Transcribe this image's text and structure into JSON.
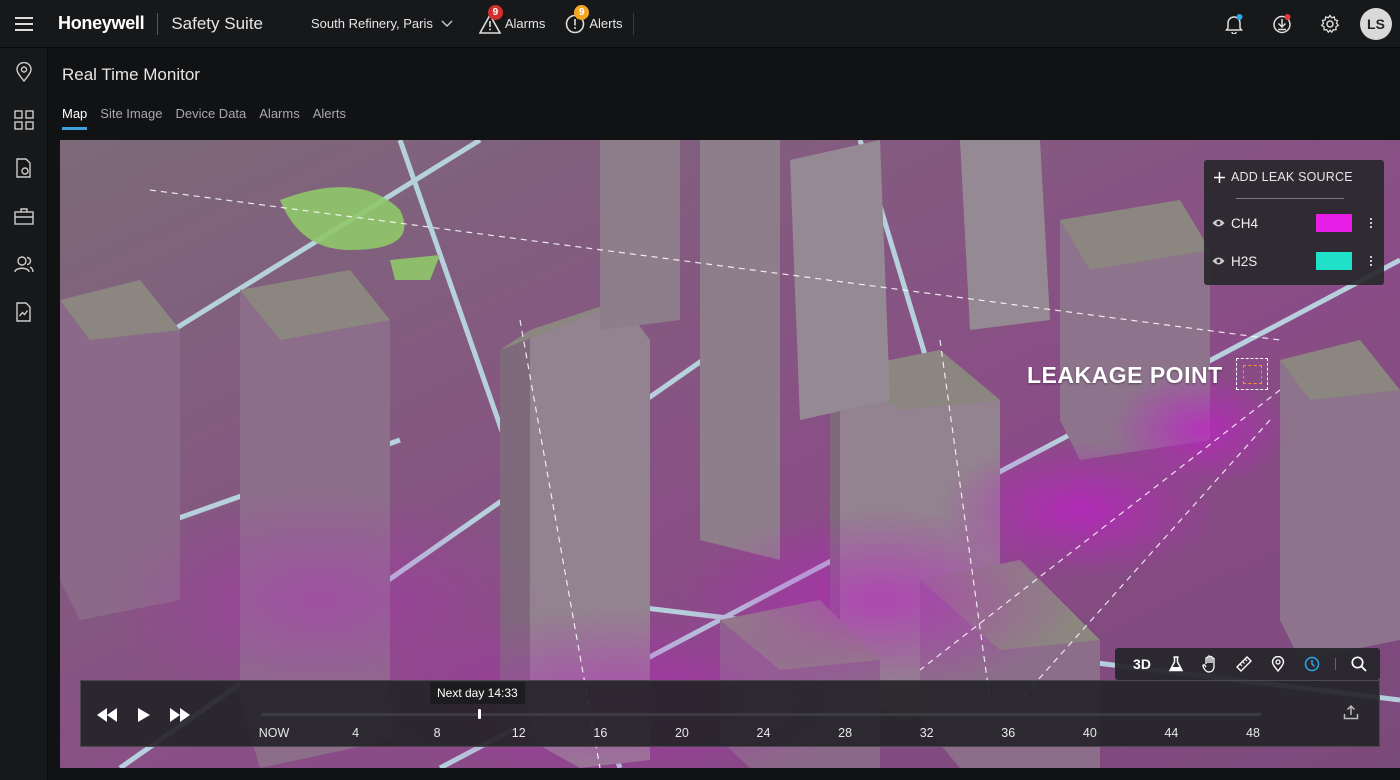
{
  "header": {
    "brand": "Honeywell",
    "product": "Safety Suite",
    "site": "South Refinery, Paris",
    "alarms": {
      "label": "Alarms",
      "count": "9",
      "badge_color": "#d32f2f"
    },
    "alerts": {
      "label": "Alerts",
      "count": "9",
      "badge_color": "#f5a623"
    },
    "user_initials": "LS"
  },
  "page": {
    "title": "Real Time Monitor",
    "tabs": [
      {
        "label": "Map",
        "active": true
      },
      {
        "label": "Site Image",
        "active": false
      },
      {
        "label": "Device Data",
        "active": false
      },
      {
        "label": "Alarms",
        "active": false
      },
      {
        "label": "Alerts",
        "active": false
      }
    ]
  },
  "leak_panel": {
    "add_label": "ADD LEAK SOURCE",
    "sources": [
      {
        "name": "CH4",
        "color": "#e61ee6"
      },
      {
        "name": "H2S",
        "color": "#1fe0c8"
      }
    ]
  },
  "map": {
    "leak_label": "LEAKAGE POINT",
    "tools": [
      "3D",
      "flask-icon",
      "hand-icon",
      "ruler-icon",
      "pin-icon",
      "clock-icon",
      "search-icon"
    ],
    "tool_3d_label": "3D"
  },
  "timeline": {
    "tooltip": "Next day 14:33",
    "position_hours": 10.1,
    "max_hours": 48,
    "ticks": [
      "NOW",
      "4",
      "8",
      "12",
      "16",
      "20",
      "24",
      "28",
      "32",
      "36",
      "40",
      "44",
      "48"
    ]
  }
}
